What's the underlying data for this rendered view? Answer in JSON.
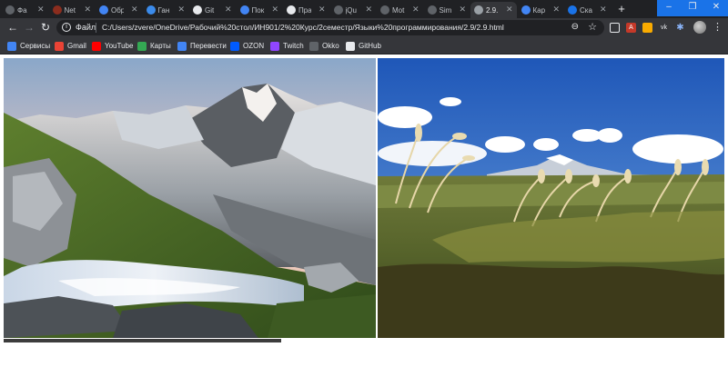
{
  "tabs": [
    {
      "title": "Фа",
      "favicon_color": "#5f6368"
    },
    {
      "title": "Net",
      "favicon_color": "#8b2d1e"
    },
    {
      "title": "Обр",
      "favicon_color": "#4285f4"
    },
    {
      "title": "Ган",
      "favicon_color": "#3b8beb"
    },
    {
      "title": "Git",
      "favicon_color": "#e8eaed"
    },
    {
      "title": "Пок",
      "favicon_color": "#4285f4"
    },
    {
      "title": "Пра",
      "favicon_color": "#e8eaed"
    },
    {
      "title": "jQu",
      "favicon_color": "#5f6368"
    },
    {
      "title": "Mot",
      "favicon_color": "#5f6368"
    },
    {
      "title": "Sim",
      "favicon_color": "#5f6368"
    },
    {
      "title": "2.9.",
      "favicon_color": "#9aa0a6"
    },
    {
      "title": "Кар",
      "favicon_color": "#4285f4"
    },
    {
      "title": "Ска",
      "favicon_color": "#1a73e8"
    }
  ],
  "active_tab_index": 10,
  "toolbar": {
    "protocol_label": "Файл",
    "url": "C:/Users/zvere/OneDrive/Рабочий%20стол/ИН901/2%20Курс/2семестр/Языки%20программирования/2.9/2.9.html"
  },
  "bookmarks": [
    {
      "label": "Сервисы",
      "icon": "apps-grid-icon",
      "color": "#4285f4"
    },
    {
      "label": "Gmail",
      "icon": "gmail-icon",
      "color": "#ea4335"
    },
    {
      "label": "YouTube",
      "icon": "youtube-icon",
      "color": "#ff0000"
    },
    {
      "label": "Карты",
      "icon": "maps-icon",
      "color": "#34a853"
    },
    {
      "label": "Перевести",
      "icon": "translate-icon",
      "color": "#4285f4"
    },
    {
      "label": "OZON",
      "icon": "ozon-icon",
      "color": "#005bff"
    },
    {
      "label": "Twitch",
      "icon": "twitch-icon",
      "color": "#9146ff"
    },
    {
      "label": "Okko",
      "icon": "okko-icon",
      "color": "#5f6368"
    },
    {
      "label": "GitHub",
      "icon": "github-icon",
      "color": "#e8eaed"
    }
  ],
  "images": [
    {
      "subject": "mountain-stream-landscape"
    },
    {
      "subject": "grassland-pampas-landscape"
    }
  ]
}
